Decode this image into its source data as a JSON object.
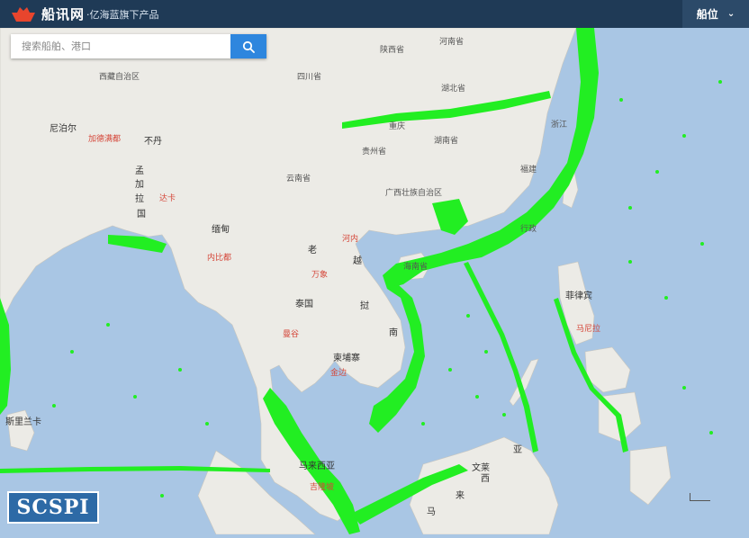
{
  "header": {
    "brand_name": "船讯网",
    "brand_sub": "·亿海蓝旗下产品",
    "menu_label": "船位"
  },
  "search": {
    "placeholder": "搜索船舶、港口"
  },
  "watermark": {
    "text": "SCSPI"
  },
  "colors": {
    "header_bg": "#1f3a56",
    "search_button": "#2e86de",
    "ship_dots": "#22ee22",
    "sea": "#a9c6e4",
    "land": "#ecebe6",
    "city": "#d5473a"
  },
  "map": {
    "labels": [
      {
        "text": "河南省",
        "type": "province"
      },
      {
        "text": "陕西省",
        "type": "province"
      },
      {
        "text": "四川省",
        "type": "province"
      },
      {
        "text": "湖北省",
        "type": "province"
      },
      {
        "text": "重庆",
        "type": "province"
      },
      {
        "text": "西藏自治区",
        "type": "province"
      },
      {
        "text": "尼泊尔",
        "type": "country"
      },
      {
        "text": "加德满都",
        "type": "city"
      },
      {
        "text": "不丹",
        "type": "country"
      },
      {
        "text": "贵州省",
        "type": "province"
      },
      {
        "text": "湖南省",
        "type": "province"
      },
      {
        "text": "浙江",
        "type": "province"
      },
      {
        "text": "福建",
        "type": "province"
      },
      {
        "text": "云南省",
        "type": "province"
      },
      {
        "text": "广西壮族自治区",
        "type": "province"
      },
      {
        "text": "孟",
        "type": "country"
      },
      {
        "text": "加",
        "type": "country"
      },
      {
        "text": "拉",
        "type": "country"
      },
      {
        "text": "国",
        "type": "country"
      },
      {
        "text": "达卡",
        "type": "city"
      },
      {
        "text": "缅甸",
        "type": "country"
      },
      {
        "text": "内比都",
        "type": "city"
      },
      {
        "text": "老",
        "type": "country"
      },
      {
        "text": "河内",
        "type": "city"
      },
      {
        "text": "越",
        "type": "country"
      },
      {
        "text": "挝",
        "type": "country"
      },
      {
        "text": "万象",
        "type": "city"
      },
      {
        "text": "海南省",
        "type": "province"
      },
      {
        "text": "泰国",
        "type": "country"
      },
      {
        "text": "曼谷",
        "type": "city"
      },
      {
        "text": "柬埔寨",
        "type": "country"
      },
      {
        "text": "金边",
        "type": "city"
      },
      {
        "text": "南",
        "type": "country"
      },
      {
        "text": "菲律宾",
        "type": "country"
      },
      {
        "text": "马尼拉",
        "type": "city"
      },
      {
        "text": "斯里兰卡",
        "type": "country"
      },
      {
        "text": "马来西亚",
        "type": "country"
      },
      {
        "text": "吉隆坡",
        "type": "city"
      },
      {
        "text": "文莱",
        "type": "country"
      },
      {
        "text": "西",
        "type": "country"
      },
      {
        "text": "亚",
        "type": "country"
      },
      {
        "text": "来",
        "type": "country"
      },
      {
        "text": "马",
        "type": "country"
      },
      {
        "text": "行政",
        "type": "province"
      }
    ]
  }
}
